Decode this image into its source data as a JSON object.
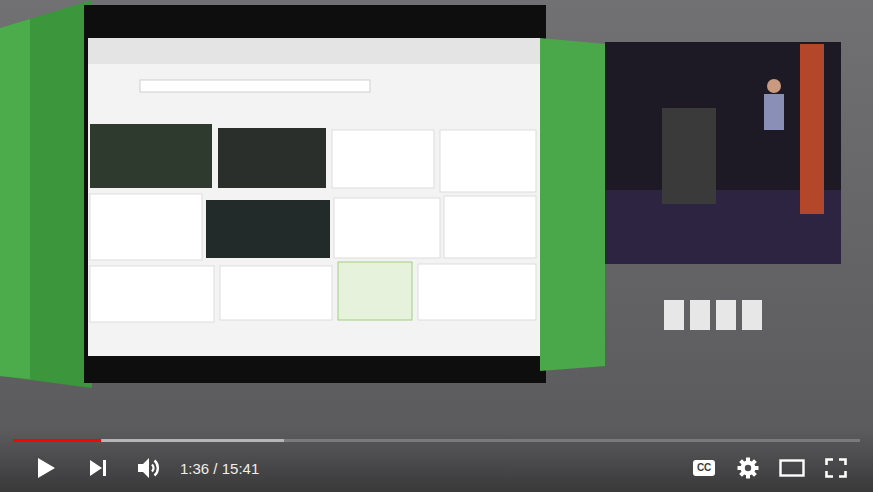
{
  "player": {
    "paused": true,
    "muted": false,
    "time": "1:36 / 15:41",
    "progress": {
      "level": 0.104,
      "buffered": 0.32
    },
    "captions": {
      "label": "CC"
    }
  }
}
